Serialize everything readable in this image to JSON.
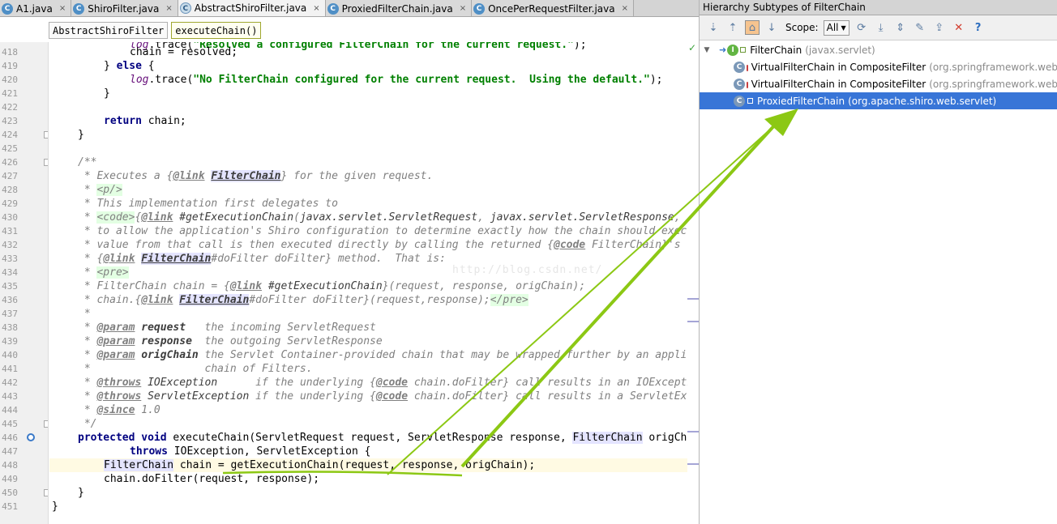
{
  "editor": {
    "tabs": [
      {
        "label": "A1.java",
        "icon": "class-icon",
        "active": false
      },
      {
        "label": "ShiroFilter.java",
        "icon": "class-icon",
        "active": false
      },
      {
        "label": "AbstractShiroFilter.java",
        "icon": "abstract-class-icon",
        "active": true
      },
      {
        "label": "ProxiedFilterChain.java",
        "icon": "class-icon",
        "active": false
      },
      {
        "label": "OncePerRequestFilter.java",
        "icon": "class-icon",
        "active": false
      }
    ],
    "close_glyph": "×",
    "breadcrumb": {
      "class": "AbstractShiroFilter",
      "method": "executeChain()"
    },
    "line_numbers": [
      "418",
      "419",
      "420",
      "421",
      "422",
      "423",
      "424",
      "425",
      "426",
      "427",
      "428",
      "429",
      "430",
      "431",
      "432",
      "433",
      "434",
      "435",
      "436",
      "437",
      "438",
      "439",
      "440",
      "441",
      "442",
      "443",
      "444",
      "445",
      "446",
      "447",
      "448",
      "449",
      "450",
      "451"
    ],
    "watermark": "http://blog.csdn.net/"
  },
  "hierarchy": {
    "title": "Hierarchy Subtypes of FilterChain",
    "scope_label": "Scope:",
    "scope_value": "All",
    "toolbar_icons": [
      "subtypes-hierarchy-icon",
      "supertypes-hierarchy-icon",
      "class-hierarchy-icon",
      "sort-alphabetically-icon"
    ],
    "toolbar_icons_right": [
      "refresh-icon",
      "autoscroll-to-source-icon",
      "expand-all-icon",
      "pin-icon",
      "export-icon",
      "close-icon",
      "help-icon"
    ],
    "nodes": [
      {
        "name": "FilterChain",
        "pkg": "(javax.servlet)",
        "depth": 0,
        "expanded": true,
        "selected": false
      },
      {
        "name": "VirtualFilterChain in CompositeFilter",
        "pkg": "(org.springframework.web",
        "depth": 1,
        "locked": true,
        "selected": false
      },
      {
        "name": "VirtualFilterChain in CompositeFilter",
        "pkg": "(org.springframework.web",
        "depth": 1,
        "locked": true,
        "selected": false
      },
      {
        "name": "ProxiedFilterChain",
        "pkg": "(org.apache.shiro.web.servlet)",
        "depth": 1,
        "locked": false,
        "selected": true
      }
    ]
  },
  "colors": {
    "accent_arrow": "#8cc814",
    "selection": "#3875d7",
    "current_line": "#fffae3"
  }
}
